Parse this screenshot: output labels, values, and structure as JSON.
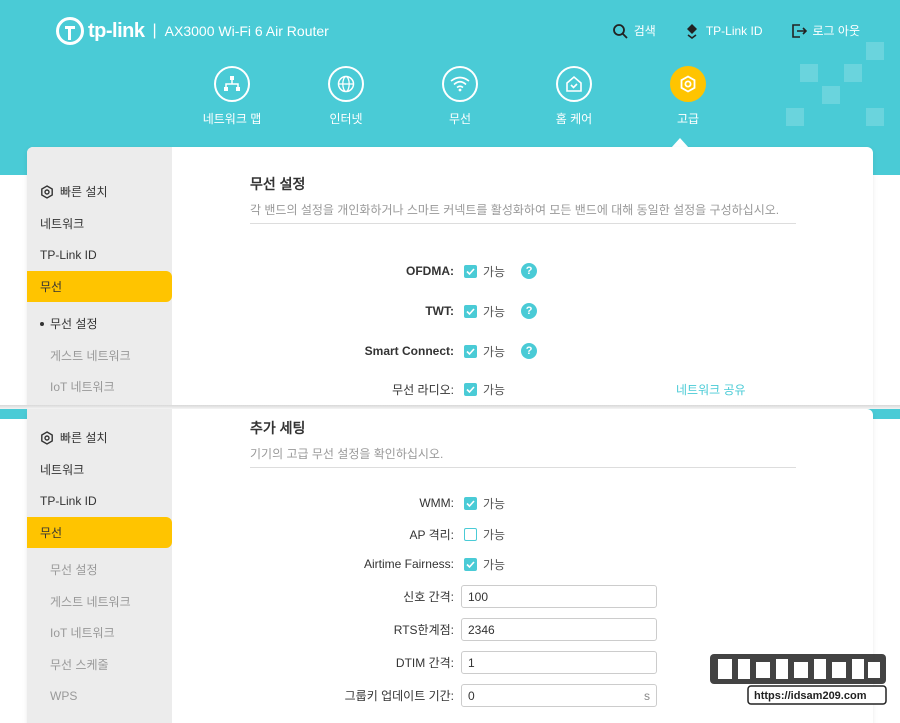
{
  "header": {
    "brand": "tp-link",
    "model": "AX3000 Wi-Fi 6 Air Router",
    "links": [
      {
        "label": "검색",
        "icon": "search-icon"
      },
      {
        "label": "TP-Link ID",
        "icon": "tplink-id-icon"
      },
      {
        "label": "로그 아웃",
        "icon": "logout-icon"
      }
    ]
  },
  "nav": [
    {
      "label": "네트워크 맵",
      "icon": "network-map-icon"
    },
    {
      "label": "인터넷",
      "icon": "globe-icon"
    },
    {
      "label": "무선",
      "icon": "wifi-icon"
    },
    {
      "label": "홈 케어",
      "icon": "home-care-icon"
    },
    {
      "label": "고급",
      "icon": "gear-icon",
      "active": true
    }
  ],
  "top": {
    "sidebar": [
      "빠른 설치",
      "네트워크",
      "TP-Link ID",
      "무선",
      "무선 설정",
      "게스트 네트워크",
      "IoT 네트워크"
    ],
    "title": "무선 설정",
    "desc": "각 밴드의 설정을 개인화하거나 스마트 커넥트를 활성화하여 모든 밴드에 대해 동일한 설정을 구성하십시오.",
    "enable": "가능",
    "rows": {
      "ofdma": "OFDMA:",
      "twt": "TWT:",
      "smart": "Smart Connect:",
      "radio": "무선 라디오:"
    },
    "share": "네트워크 공유"
  },
  "bottom": {
    "sidebar": [
      "빠른 설치",
      "네트워크",
      "TP-Link ID",
      "무선",
      "무선 설정",
      "게스트 네트워크",
      "IoT 네트워크",
      "무선 스케줄",
      "WPS"
    ],
    "title": "추가 세팅",
    "desc": "기기의 고급 무선 설정을 확인하십시오.",
    "enable": "가능",
    "wmm": "WMM:",
    "ap": "AP 격리:",
    "airtime": "Airtime Fairness:",
    "beacon_label": "신호 간격:",
    "beacon_value": "100",
    "rts_label": "RTS한계점:",
    "rts_value": "2346",
    "dtim_label": "DTIM 간격:",
    "dtim_value": "1",
    "gkey_label": "그룹키 업데이트 기간:",
    "gkey_value": "0",
    "gkey_unit": "s"
  },
  "watermark": {
    "url": "https://idsam209.com"
  },
  "colors": {
    "accent": "#4acbd6",
    "active": "#ffc400"
  }
}
